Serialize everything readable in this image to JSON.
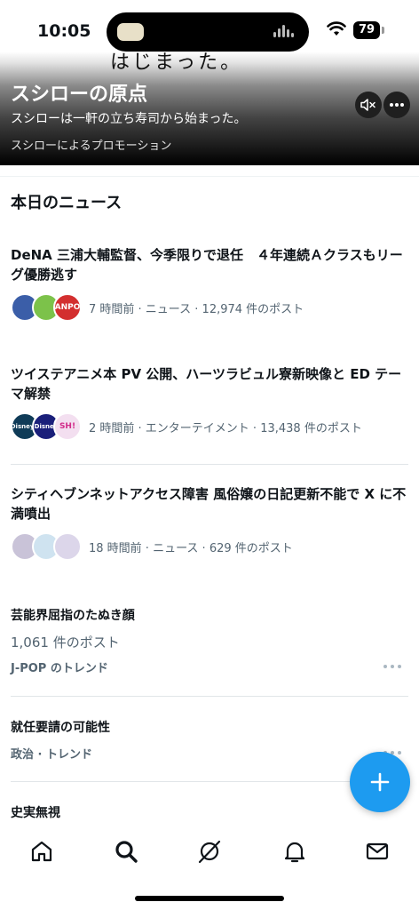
{
  "status_bar": {
    "time": "10:05",
    "battery": "79"
  },
  "promo": {
    "handwriting": "はじまった。",
    "title": "スシローの原点",
    "subtitle": "スシローは一軒の立ち寿司から始まった。",
    "credit": "スシローによるプロモーション"
  },
  "section_title": "本日のニュース",
  "news": [
    {
      "title": "DeNA 三浦大輔監督、今季限りで退任　４年連続Ａクラスもリーグ優勝逃す",
      "meta": "7 時間前 · ニュース · 12,974 件のポスト",
      "avatars": [
        {
          "label": "",
          "color": "#3b5ea8"
        },
        {
          "label": "",
          "color": "#7cc24a"
        },
        {
          "label": "ANPO",
          "color": "#d32f2f"
        }
      ]
    },
    {
      "title": "ツイステアニメ本 PV 公開、ハーツラビュル寮新映像と ED テーマ解禁",
      "meta": "2 時間前 · エンターテイメント · 13,438 件のポスト",
      "avatars": [
        {
          "label": "Disney+",
          "color": "#0f3b57"
        },
        {
          "label": "Disney",
          "color": "#1a1f7a"
        },
        {
          "label": "SH!",
          "color": "#f3dff0"
        }
      ]
    },
    {
      "title": "シティヘブンネットアクセス障害 風俗嬢の日記更新不能で X に不満噴出",
      "meta": "18 時間前 · ニュース · 629 件のポスト",
      "avatars": [
        {
          "label": "",
          "color": "#c9c3d8"
        },
        {
          "label": "",
          "color": "#cfe3f0"
        },
        {
          "label": "",
          "color": "#dcd6ea"
        }
      ]
    }
  ],
  "trends": [
    {
      "title": "芸能界屈指のたぬき顔",
      "count": "1,061 件のポスト",
      "category": "J-POP のトレンド"
    },
    {
      "title": "就任要請の可能性",
      "count": "",
      "category": "政治 · トレンド"
    },
    {
      "title": "史実無視",
      "count": "",
      "category": ""
    }
  ],
  "nav": [
    "home-icon",
    "search-icon",
    "grok-icon",
    "notifications-icon",
    "messages-icon"
  ],
  "colors": {
    "accent": "#1d9bf0",
    "text": "#0f1419",
    "secondary": "#536471"
  }
}
